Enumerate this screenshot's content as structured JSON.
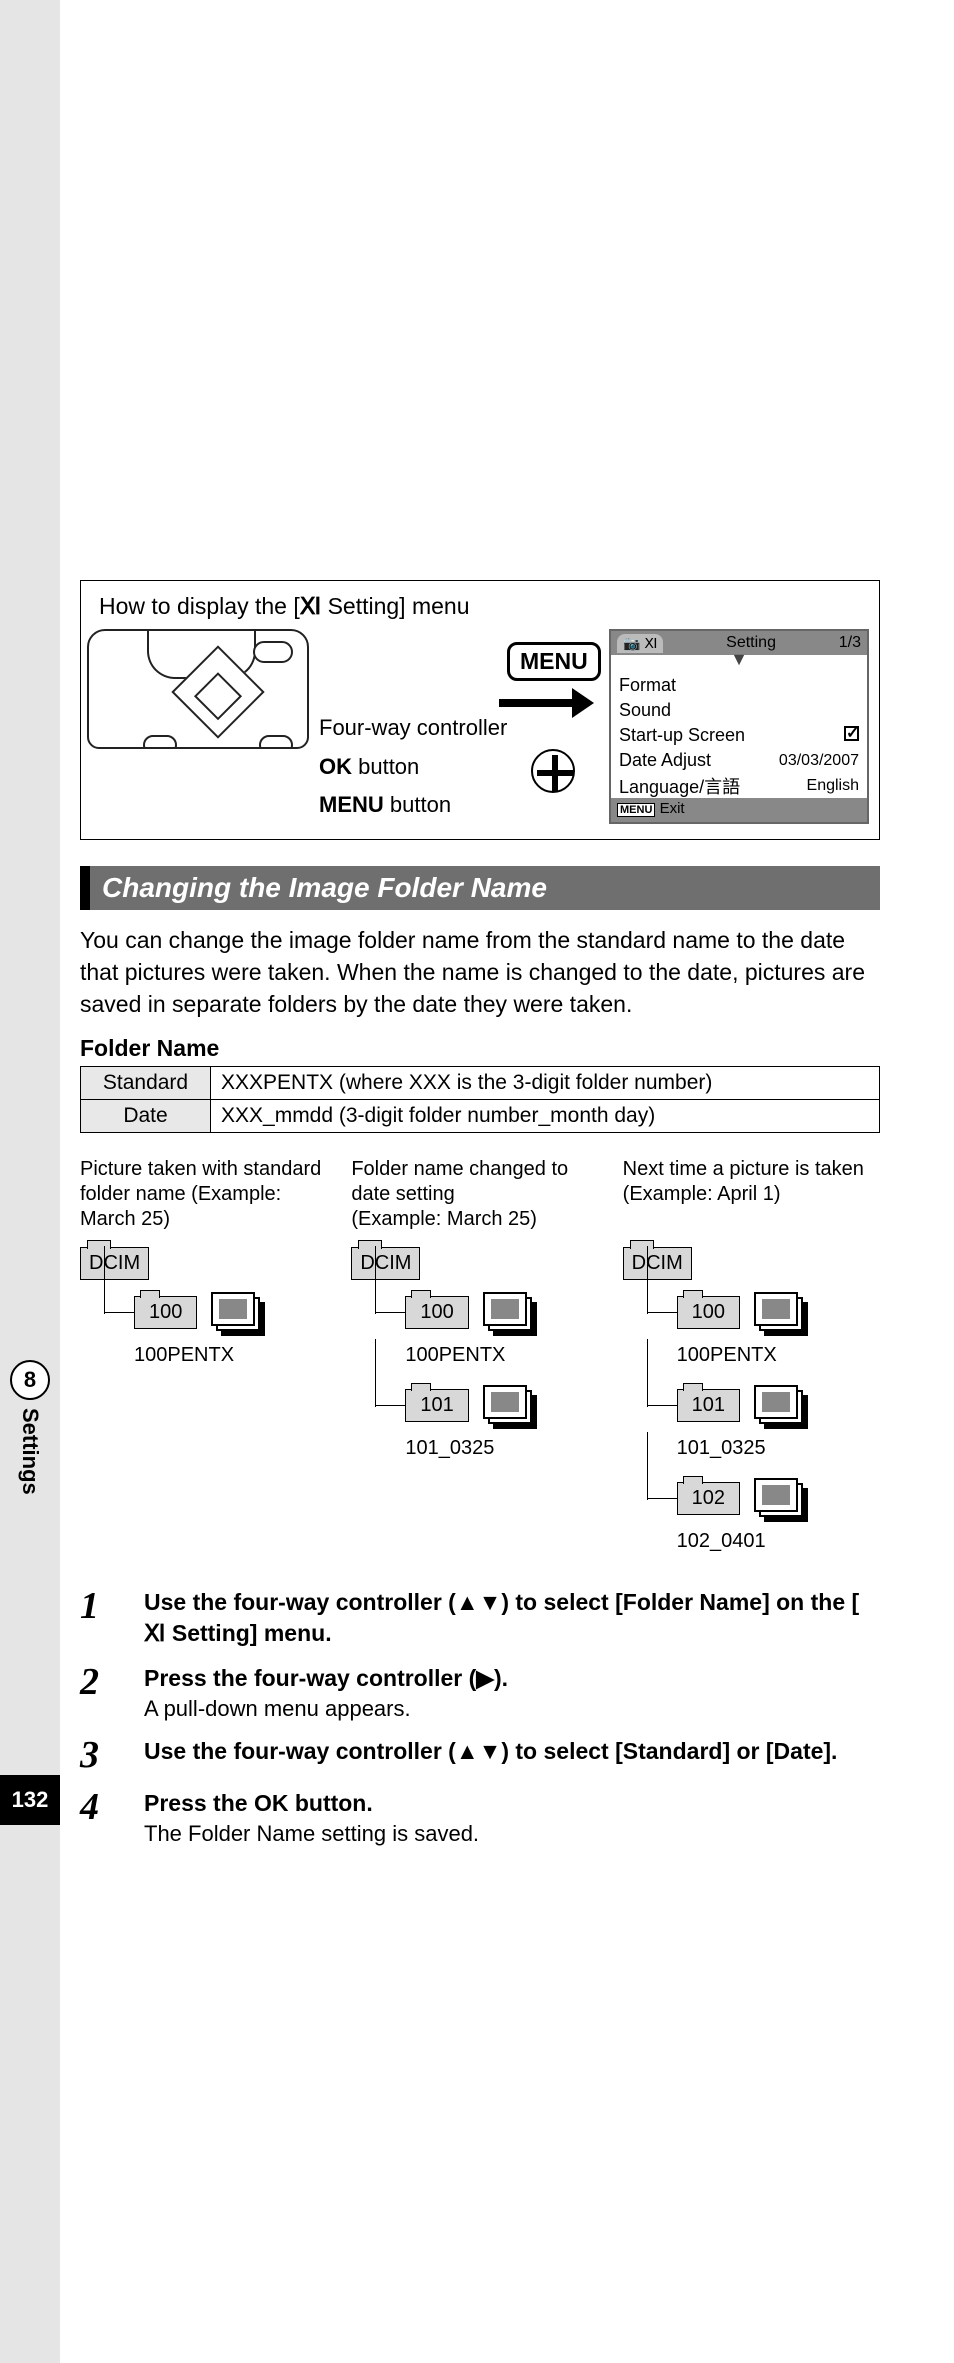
{
  "page_number": "132",
  "side_chapter_num": "8",
  "side_chapter_label": "Settings",
  "menu_box": {
    "title_prefix": "How to display the [",
    "title_icon": "⚙",
    "title_suffix": " Setting] menu",
    "label_fourway": "Four-way controller",
    "label_ok_bold": "OK",
    "label_ok_suffix": " button",
    "label_menu_bold": "MENU",
    "label_menu_suffix": " button",
    "menu_badge": "MENU"
  },
  "lcd": {
    "header_tabs_icon": "📷 ⚙",
    "header_label": "Setting",
    "header_page": "1/3",
    "rows": [
      {
        "label": "Format",
        "value": ""
      },
      {
        "label": "Sound",
        "value": ""
      },
      {
        "label": "Start-up Screen",
        "value": "check"
      },
      {
        "label": "Date Adjust",
        "value": "03/03/2007"
      },
      {
        "label": "Language/言語",
        "value": "English"
      }
    ],
    "footer_key": "MENU",
    "footer_text": "Exit"
  },
  "section_heading": "Changing the Image Folder Name",
  "intro_text": "You can change the image folder name from the standard name to the date that pictures were taken. When the name is changed to the date, pictures are saved in separate folders by the date they were taken.",
  "folder_name_heading": "Folder Name",
  "table": {
    "row1_label": "Standard",
    "row1_value": "XXXPENTX (where XXX is the 3-digit folder number)",
    "row2_label": "Date",
    "row2_value": "XXX_mmdd (3-digit folder number_month day)"
  },
  "diagrams": [
    {
      "caption": "Picture taken with standard folder name (Example: March 25)",
      "dcim": "DCIM",
      "folders": [
        {
          "num": "100",
          "label": "100PENTX"
        }
      ]
    },
    {
      "caption": "Folder name changed to date setting\n(Example: March 25)",
      "dcim": "DCIM",
      "folders": [
        {
          "num": "100",
          "label": "100PENTX"
        },
        {
          "num": "101",
          "label": "101_0325"
        }
      ]
    },
    {
      "caption": "Next time a picture is taken\n(Example: April 1)",
      "dcim": "DCIM",
      "folders": [
        {
          "num": "100",
          "label": "100PENTX"
        },
        {
          "num": "101",
          "label": "101_0325"
        },
        {
          "num": "102",
          "label": "102_0401"
        }
      ]
    }
  ],
  "steps": [
    {
      "num": "1",
      "title_pre": "Use the four-way controller (▲▼) to select [Folder Name] on the [",
      "title_icon": "⚙",
      "title_post": " Setting] menu.",
      "desc": ""
    },
    {
      "num": "2",
      "title_pre": "Press the four-way controller (▶).",
      "title_icon": "",
      "title_post": "",
      "desc": "A pull-down menu appears."
    },
    {
      "num": "3",
      "title_pre": "Use the four-way controller (▲▼) to select [Standard] or [Date].",
      "title_icon": "",
      "title_post": "",
      "desc": ""
    },
    {
      "num": "4",
      "title_pre": "Press the ",
      "title_ok": "OK",
      "title_post": " button.",
      "desc": "The Folder Name setting is saved."
    }
  ]
}
